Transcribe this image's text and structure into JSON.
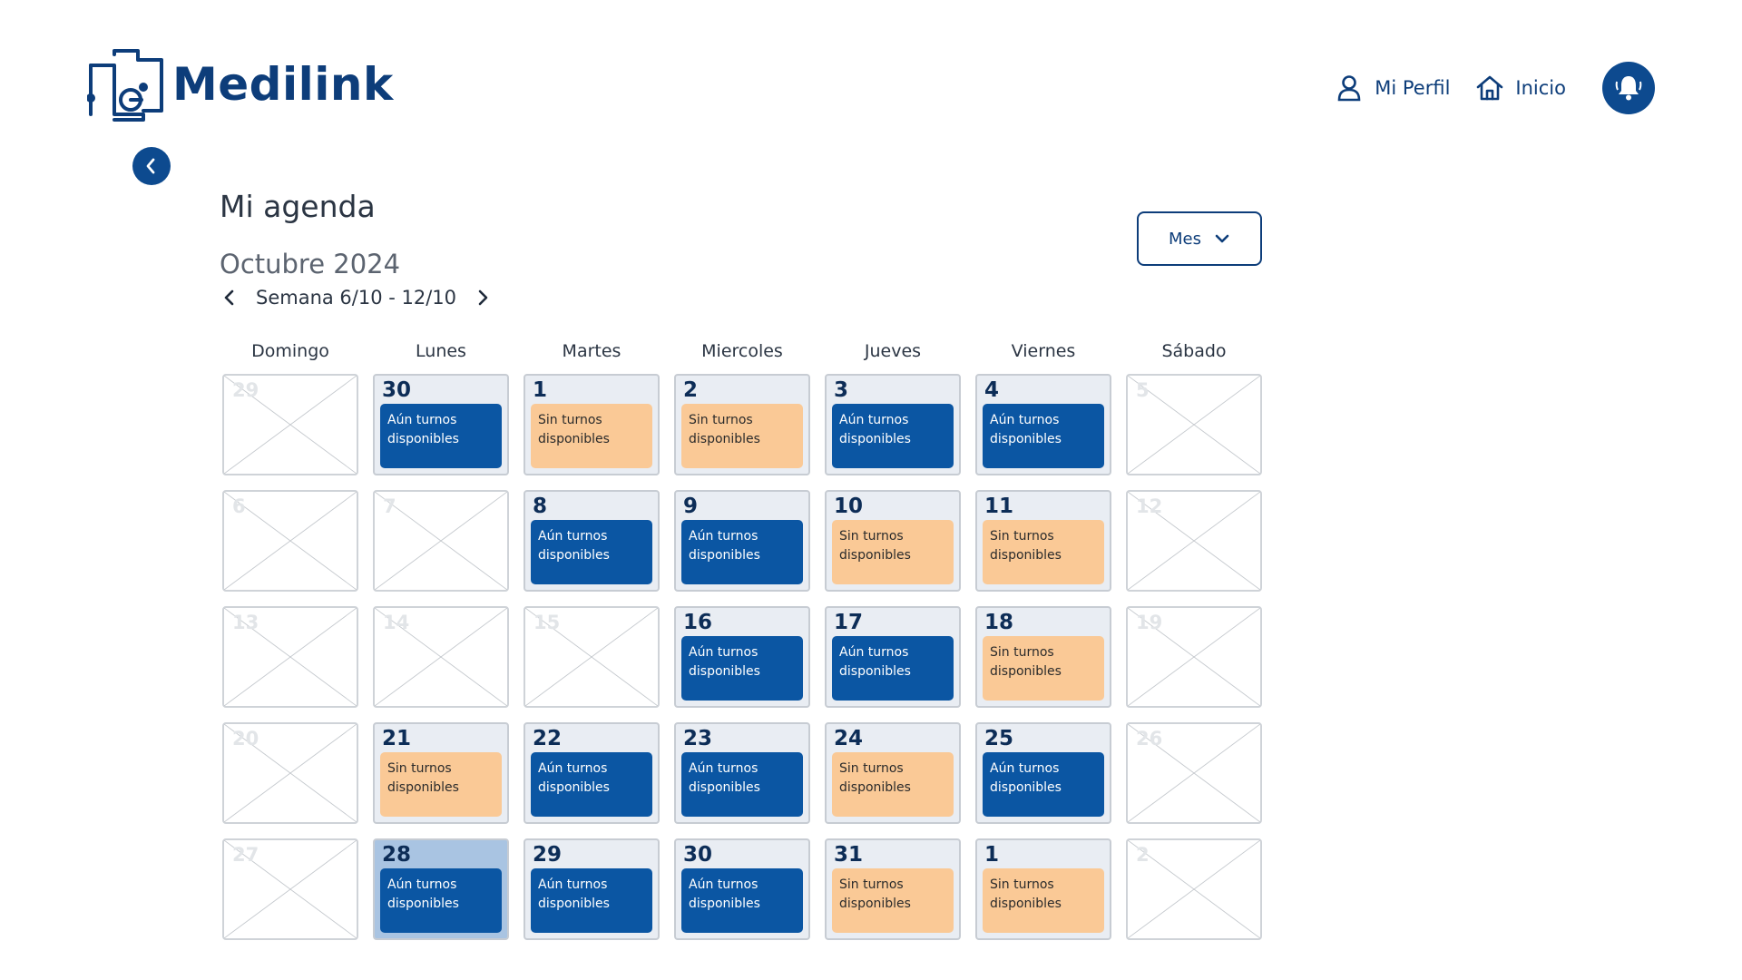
{
  "app": {
    "logo_text": "Medilink"
  },
  "nav": {
    "profile_label": "Mi Perfil",
    "home_label": "Inicio"
  },
  "page": {
    "title": "Mi agenda",
    "month": "Octubre 2024",
    "week_label": "Semana 6/10 - 12/10",
    "view_label": "Mes"
  },
  "colors": {
    "primary": "#0d4a8f",
    "available": "#0b56a3",
    "unavailable": "#fac996",
    "selected": "#a9c4e2"
  },
  "icons": {
    "profile": "user-icon",
    "home": "home-icon",
    "bell": "bell-icon",
    "back": "chevron-left-icon",
    "prev": "chevron-left-icon",
    "next": "chevron-right-icon",
    "dropdown": "chevron-down-icon"
  },
  "weekdays": [
    "Domingo",
    "Lunes",
    "Martes",
    "Miercoles",
    "Jueves",
    "Viernes",
    "Sábado"
  ],
  "status_labels": {
    "available": "Aún turnos disponibles",
    "none": "Sin turnos disponibles"
  },
  "weeks": [
    [
      {
        "day": "29",
        "status": "empty"
      },
      {
        "day": "30",
        "status": "available"
      },
      {
        "day": "1",
        "status": "none"
      },
      {
        "day": "2",
        "status": "none"
      },
      {
        "day": "3",
        "status": "available"
      },
      {
        "day": "4",
        "status": "available"
      },
      {
        "day": "5",
        "status": "empty"
      }
    ],
    [
      {
        "day": "6",
        "status": "empty"
      },
      {
        "day": "7",
        "status": "empty"
      },
      {
        "day": "8",
        "status": "available"
      },
      {
        "day": "9",
        "status": "available"
      },
      {
        "day": "10",
        "status": "none"
      },
      {
        "day": "11",
        "status": "none"
      },
      {
        "day": "12",
        "status": "empty"
      }
    ],
    [
      {
        "day": "13",
        "status": "empty"
      },
      {
        "day": "14",
        "status": "empty"
      },
      {
        "day": "15",
        "status": "empty"
      },
      {
        "day": "16",
        "status": "available"
      },
      {
        "day": "17",
        "status": "available"
      },
      {
        "day": "18",
        "status": "none"
      },
      {
        "day": "19",
        "status": "empty"
      }
    ],
    [
      {
        "day": "20",
        "status": "empty"
      },
      {
        "day": "21",
        "status": "none"
      },
      {
        "day": "22",
        "status": "available"
      },
      {
        "day": "23",
        "status": "available"
      },
      {
        "day": "24",
        "status": "none"
      },
      {
        "day": "25",
        "status": "available"
      },
      {
        "day": "26",
        "status": "empty"
      }
    ],
    [
      {
        "day": "27",
        "status": "empty"
      },
      {
        "day": "28",
        "status": "available",
        "selected": true
      },
      {
        "day": "29",
        "status": "available"
      },
      {
        "day": "30",
        "status": "available"
      },
      {
        "day": "31",
        "status": "none"
      },
      {
        "day": "1",
        "status": "none"
      },
      {
        "day": "2",
        "status": "empty"
      }
    ]
  ]
}
